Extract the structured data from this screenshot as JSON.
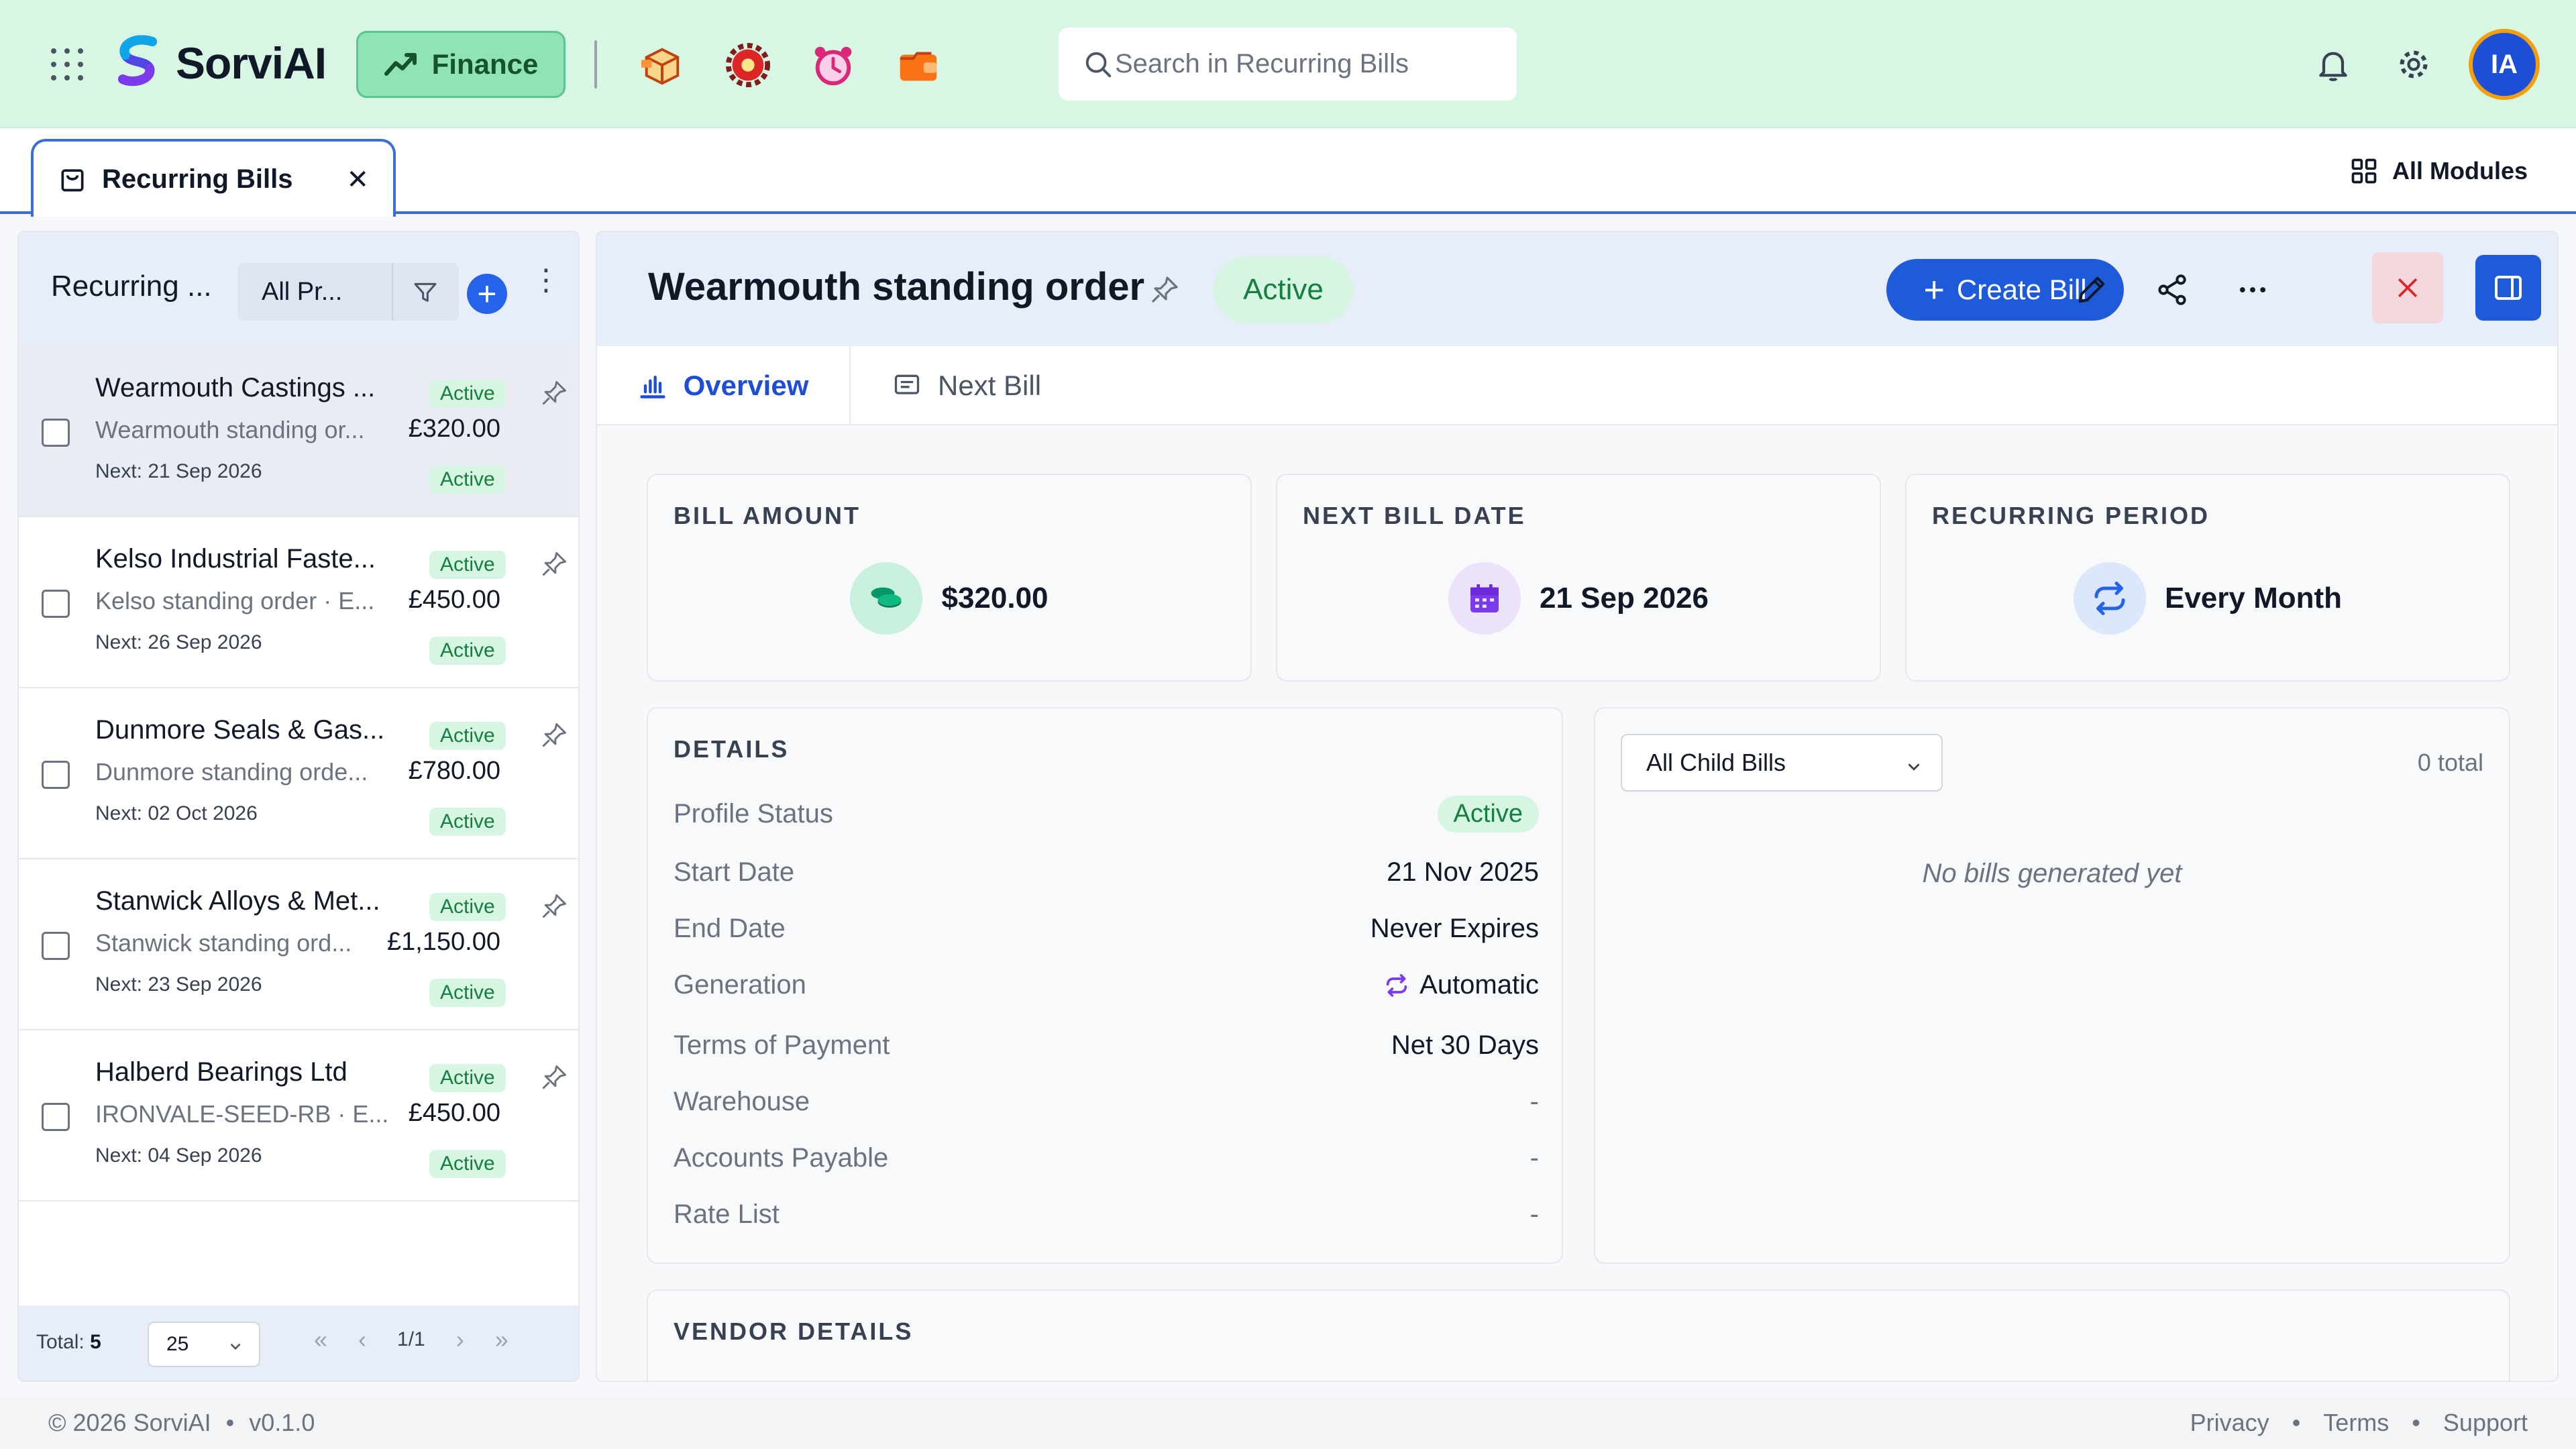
{
  "app": {
    "name": "SorviAI",
    "module": "Finance",
    "search_placeholder": "Search in Recurring Bills",
    "avatar_initials": "IA",
    "colors": {
      "topbar": "#d8f6e4",
      "accent": "#1d5bdb",
      "active_badge_bg": "#d6f5e3",
      "active_badge_text": "#15803d"
    }
  },
  "tabs": {
    "open_tab": "Recurring Bills",
    "all_modules": "All Modules"
  },
  "list": {
    "title": "Recurring ...",
    "filter": "All Pr...",
    "items": [
      {
        "name": "Wearmouth Castings ...",
        "sub": "Wearmouth standing or...",
        "amount": "£320.00",
        "next": "Next: 21 Sep 2026",
        "status": "Active",
        "status2": "Active"
      },
      {
        "name": "Kelso Industrial Faste...",
        "sub": "Kelso standing order · E...",
        "amount": "£450.00",
        "next": "Next: 26 Sep 2026",
        "status": "Active",
        "status2": "Active"
      },
      {
        "name": "Dunmore Seals & Gas...",
        "sub": "Dunmore standing orde...",
        "amount": "£780.00",
        "next": "Next: 02 Oct 2026",
        "status": "Active",
        "status2": "Active"
      },
      {
        "name": "Stanwick Alloys & Met...",
        "sub": "Stanwick standing ord...",
        "amount": "£1,150.00",
        "next": "Next: 23 Sep 2026",
        "status": "Active",
        "status2": "Active"
      },
      {
        "name": "Halberd Bearings Ltd",
        "sub": "IRONVALE-SEED-RB · E...",
        "amount": "£450.00",
        "next": "Next: 04 Sep 2026",
        "status": "Active",
        "status2": "Active"
      }
    ],
    "footer": {
      "total_label": "Total:",
      "total_value": "5",
      "page_size": "25",
      "page": "1/1"
    }
  },
  "detail": {
    "title": "Wearmouth standing order",
    "status": "Active",
    "create_label": "Create Bill",
    "tabs": [
      "Overview",
      "Next Bill"
    ],
    "stats": [
      {
        "label": "BILL AMOUNT",
        "value": "$320.00",
        "icon": "coins-icon"
      },
      {
        "label": "NEXT BILL DATE",
        "value": "21 Sep 2026",
        "icon": "calendar-icon"
      },
      {
        "label": "RECURRING PERIOD",
        "value": "Every Month",
        "icon": "repeat-icon"
      }
    ],
    "details": {
      "title": "DETAILS",
      "rows": [
        {
          "k": "Profile Status",
          "v": "Active"
        },
        {
          "k": "Start Date",
          "v": "21 Nov 2025"
        },
        {
          "k": "End Date",
          "v": "Never Expires"
        },
        {
          "k": "Generation",
          "v": "Automatic"
        },
        {
          "k": "Terms of Payment",
          "v": "Net 30 Days"
        },
        {
          "k": "Warehouse",
          "v": "-"
        },
        {
          "k": "Accounts Payable",
          "v": "-"
        },
        {
          "k": "Rate List",
          "v": "-"
        }
      ]
    },
    "child_bills": {
      "select": "All Child Bills",
      "total": "0 total",
      "empty": "No bills generated yet"
    },
    "vendor_title": "VENDOR DETAILS"
  },
  "footer": {
    "copyright": "© 2026 SorviAI",
    "version": "v0.1.0",
    "links": [
      "Privacy",
      "Terms",
      "Support"
    ]
  }
}
